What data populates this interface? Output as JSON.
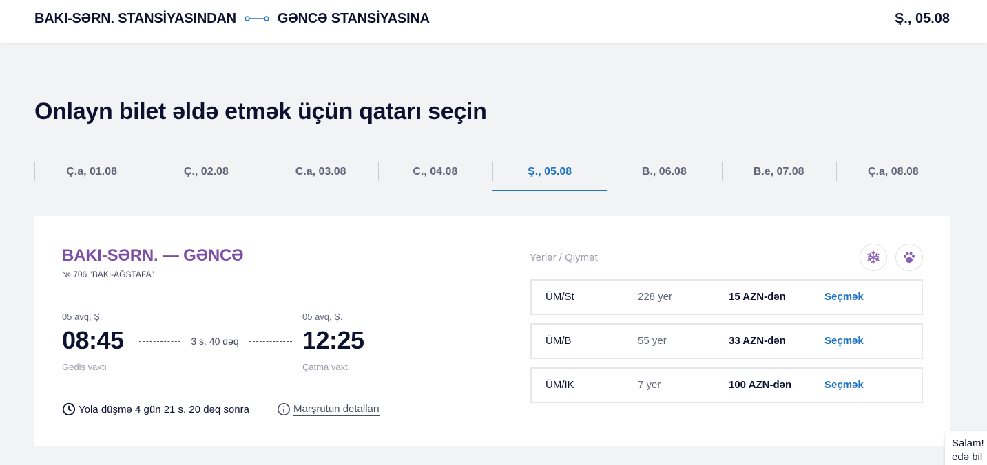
{
  "header": {
    "from": "BAKI-SƏRN. STANSİYASINDAN",
    "to": "GƏNCƏ STANSİYASINA",
    "date": "Ş., 05.08"
  },
  "page_title": "Onlayn bilet əldə etmək üçün qatarı seçin",
  "date_tabs": [
    {
      "label": "Ç.a, 01.08",
      "active": false
    },
    {
      "label": "Ç., 02.08",
      "active": false
    },
    {
      "label": "C.a, 03.08",
      "active": false
    },
    {
      "label": "C., 04.08",
      "active": false
    },
    {
      "label": "Ş., 05.08",
      "active": true
    },
    {
      "label": "B., 06.08",
      "active": false
    },
    {
      "label": "B.e, 07.08",
      "active": false
    },
    {
      "label": "Ç.a, 08.08",
      "active": false
    }
  ],
  "train": {
    "route": "BAKI-SƏRN. — GƏNCƏ",
    "number": "№ 706 \"BAKI-AĞSTAFA\"",
    "departure": {
      "date": "05 avq, Ş.",
      "time": "08:45",
      "label": "Gediş vaxtı"
    },
    "arrival": {
      "date": "05 avq, Ş.",
      "time": "12:25",
      "label": "Çatma vaxtı"
    },
    "duration": "3 s. 40 dəq",
    "countdown": "Yola düşmə 4 gün 21 s. 20 dəq sonra",
    "details_link": "Marşrutun detalları",
    "seats_header": "Yerlər / Qiymət",
    "features": [
      "snowflake-icon",
      "paw-icon"
    ],
    "seats": [
      {
        "class": "ÜM/St",
        "count": "228 yer",
        "price": "15 AZN-dən",
        "select": "Seçmək"
      },
      {
        "class": "ÜM/B",
        "count": "55 yer",
        "price": "33 AZN-dən",
        "select": "Seçmək"
      },
      {
        "class": "ÜM/IK",
        "count": "7 yer",
        "price": "100 AZN-dən",
        "select": "Seçmək"
      }
    ]
  },
  "chat": {
    "line1": "Salam!",
    "line2": "edə bil"
  },
  "colors": {
    "accent": "#1f74c4",
    "train_route": "#7b4fa5",
    "text": "#0d1130",
    "background": "#f2f3f5"
  }
}
